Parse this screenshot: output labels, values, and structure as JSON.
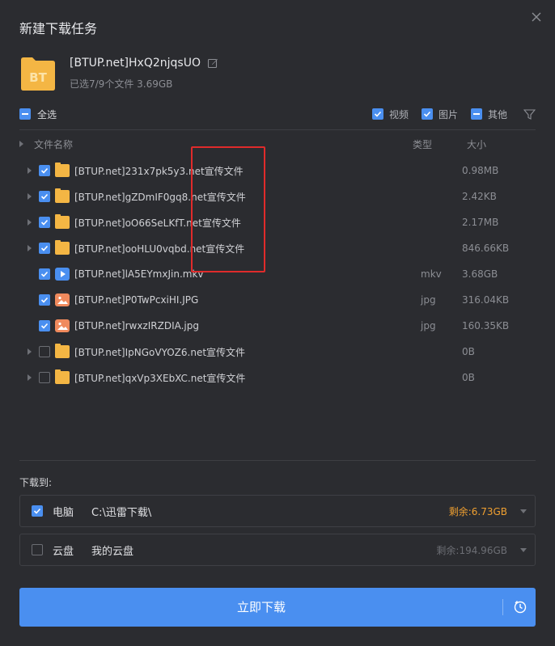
{
  "dialog": {
    "title": "新建下载任务"
  },
  "task": {
    "icon_text": "BT",
    "name": "[BTUP.net]HxQ2njqsUO",
    "summary": "已选7/9个文件 3.69GB"
  },
  "select_all": {
    "label": "全选",
    "state": "partial"
  },
  "filters": [
    {
      "label": "视频",
      "checked": true
    },
    {
      "label": "图片",
      "checked": true
    },
    {
      "label": "其他",
      "checked": "partial"
    }
  ],
  "columns": {
    "name": "文件名称",
    "type": "类型",
    "size": "大小"
  },
  "files": [
    {
      "name": "[BTUP.net]231x7pk5y3.net宣传文件",
      "kind": "folder",
      "type": "",
      "size": "0.98MB",
      "checked": true,
      "expandable": true
    },
    {
      "name": "[BTUP.net]gZDmIF0gq8.net宣传文件",
      "kind": "folder",
      "type": "",
      "size": "2.42KB",
      "checked": true,
      "expandable": true
    },
    {
      "name": "[BTUP.net]oO66SeLKfT.net宣传文件",
      "kind": "folder",
      "type": "",
      "size": "2.17MB",
      "checked": true,
      "expandable": true
    },
    {
      "name": "[BTUP.net]ooHLU0vqbd.net宣传文件",
      "kind": "folder",
      "type": "",
      "size": "846.66KB",
      "checked": true,
      "expandable": true
    },
    {
      "name": "[BTUP.net]lA5EYmxJin.mkv",
      "kind": "video",
      "type": "mkv",
      "size": "3.68GB",
      "checked": true,
      "expandable": false
    },
    {
      "name": "[BTUP.net]P0TwPcxiHI.JPG",
      "kind": "image",
      "type": "jpg",
      "size": "316.04KB",
      "checked": true,
      "expandable": false
    },
    {
      "name": "[BTUP.net]rwxzIRZDIA.jpg",
      "kind": "image",
      "type": "jpg",
      "size": "160.35KB",
      "checked": true,
      "expandable": false
    },
    {
      "name": "[BTUP.net]IpNGoVYOZ6.net宣传文件",
      "kind": "folder",
      "type": "",
      "size": "0B",
      "checked": false,
      "expandable": true
    },
    {
      "name": "[BTUP.net]qxVp3XEbXC.net宣传文件",
      "kind": "folder",
      "type": "",
      "size": "0B",
      "checked": false,
      "expandable": true
    }
  ],
  "download_to": {
    "label": "下载到:",
    "destinations": [
      {
        "name": "电脑",
        "path": "C:\\迅雷下载\\",
        "free": "剩余:6.73GB",
        "free_color": "#f0a030",
        "checked": true
      },
      {
        "name": "云盘",
        "path": "我的云盘",
        "free": "剩余:194.96GB",
        "free_color": "#6c6e74",
        "checked": false
      }
    ]
  },
  "action": {
    "label": "立即下载",
    "icon": "timer-icon"
  },
  "colors": {
    "accent": "#4a8ff0",
    "folder": "#f4b644",
    "background": "#2b2c30",
    "annotation": "#e02b2b"
  }
}
